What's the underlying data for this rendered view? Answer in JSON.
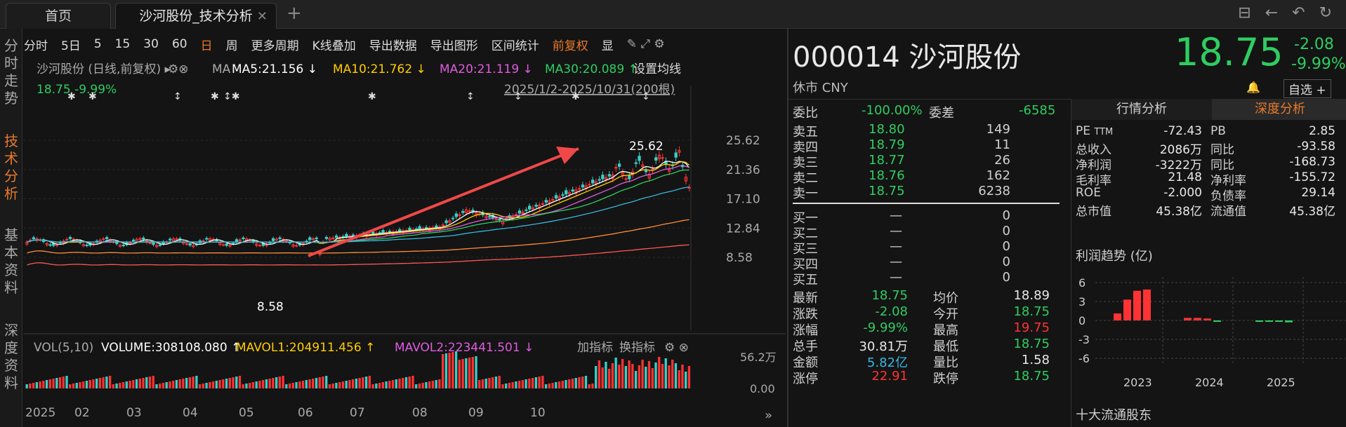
{
  "tabs": {
    "home": "首页",
    "active": "沙河股份_技术分析"
  },
  "nav": [
    "分时走势",
    "技术分析",
    "基本资料",
    "深度资料"
  ],
  "toolbar": [
    "分时",
    "5日",
    "5",
    "15",
    "30",
    "60",
    "日",
    "周",
    "更多周期",
    "K线叠加",
    "导出数据",
    "导出图形",
    "区间统计",
    "前复权",
    "显"
  ],
  "chart": {
    "stock_line": "沙河股份 (日线,前复权) ▸",
    "ma_label": "MA",
    "ma5": "MA5:21.156 ↓",
    "ma10": "MA10:21.762 ↓",
    "ma20": "MA20:21.119 ↓",
    "ma30": "MA30:20.089 ↑",
    "set_ma": "设置均线",
    "price_change": "18.75  -9.99%",
    "range": "2025/1/2-2025/10/31(200根)",
    "y_ticks": [
      "25.62",
      "21.36",
      "17.10",
      "12.84",
      "8.58"
    ],
    "high_label": "25.62",
    "low_label": "8.58",
    "vol_label": "VOL(5,10)",
    "volume": "VOLUME:308108.080 ↑",
    "mavol1": "MAVOL1:204911.456 ↑",
    "mavol2": "MAVOL2:223441.501 ↓",
    "add_ind": "加指标",
    "switch_ind": "换指标",
    "vol_ticks": [
      "56.2万",
      "0.00"
    ],
    "months": [
      "2025",
      "02",
      "03",
      "04",
      "05",
      "06",
      "07",
      "08",
      "09",
      "10"
    ],
    "colors": {
      "ma5": "#ffffff",
      "ma10": "#ffcc00",
      "ma20": "#e05ce0",
      "ma30": "#2fcd61",
      "up": "#ff3333",
      "down": "#36d0c8",
      "arrow": "#f04848"
    }
  },
  "chart_data": {
    "type": "candlestick",
    "x_range": [
      "2025/1/2",
      "2025/10/31"
    ],
    "bars": 200,
    "ylim": [
      8.58,
      25.62
    ],
    "high": 25.62,
    "low": 8.58,
    "close": 18.75,
    "months": [
      "2025",
      "02",
      "03",
      "04",
      "05",
      "06",
      "07",
      "08",
      "09",
      "10"
    ]
  },
  "quote": {
    "code_name": "000014 沙河股份",
    "price": "18.75",
    "change": "-2.08",
    "pct": "-9.99%",
    "market": "休市 CNY",
    "self_select": "自选 +",
    "webi_l": "委比",
    "webi_v": "-100.00%",
    "weicha_l": "委差",
    "weicha_v": "-6585",
    "asks": [
      {
        "l": "卖五",
        "p": "18.80",
        "v": "149"
      },
      {
        "l": "卖四",
        "p": "18.79",
        "v": "11"
      },
      {
        "l": "卖三",
        "p": "18.77",
        "v": "26"
      },
      {
        "l": "卖二",
        "p": "18.76",
        "v": "162"
      },
      {
        "l": "卖一",
        "p": "18.75",
        "v": "6238"
      }
    ],
    "bids": [
      {
        "l": "买一",
        "p": "—",
        "v": "0"
      },
      {
        "l": "买二",
        "p": "—",
        "v": "0"
      },
      {
        "l": "买三",
        "p": "—",
        "v": "0"
      },
      {
        "l": "买四",
        "p": "—",
        "v": "0"
      },
      {
        "l": "买五",
        "p": "—",
        "v": "0"
      }
    ],
    "stats": [
      [
        "最新",
        "18.75",
        "均价",
        "18.89"
      ],
      [
        "涨跌",
        "-2.08",
        "今开",
        "18.75"
      ],
      [
        "涨幅",
        "-9.99%",
        "最高",
        "19.75"
      ],
      [
        "总手",
        "30.81万",
        "最低",
        "18.75"
      ],
      [
        "金额",
        "5.82亿",
        "量比",
        "1.58"
      ],
      [
        "涨停",
        "22.91",
        "跌停",
        "18.75"
      ]
    ]
  },
  "analysis": {
    "tab1": "行情分析",
    "tab2": "深度分析",
    "pe": "PE",
    "ttm": "TTM",
    "rows": [
      [
        "PE",
        "-72.43",
        "PB",
        "2.85"
      ],
      [
        "总收入",
        "2086万",
        "同比",
        "-93.58"
      ],
      [
        "净利润",
        "-3222万",
        "同比",
        "-168.73"
      ],
      [
        "毛利率",
        "21.48",
        "净利率",
        "-155.72"
      ],
      [
        "ROE",
        "-2.000",
        "负债率",
        "29.14"
      ],
      [
        "总市值",
        "45.38亿",
        "流通值",
        "45.38亿"
      ]
    ],
    "profit_title": "利润趋势 (亿)",
    "profit_y": [
      "6",
      "3",
      "0",
      "-3",
      "-6"
    ],
    "profit_x": [
      "2023",
      "2024",
      "2025"
    ],
    "top10": "十大流通股东"
  },
  "profit_chart": {
    "type": "bar",
    "years": [
      "2023",
      "2024",
      "2025"
    ],
    "values": [
      1.1,
      3.3,
      4.7,
      4.9,
      0.4,
      0.4,
      0.3,
      -0.1,
      -0.1,
      -0.1,
      -0.2,
      -0.3
    ],
    "ylim": [
      -6,
      6
    ]
  }
}
